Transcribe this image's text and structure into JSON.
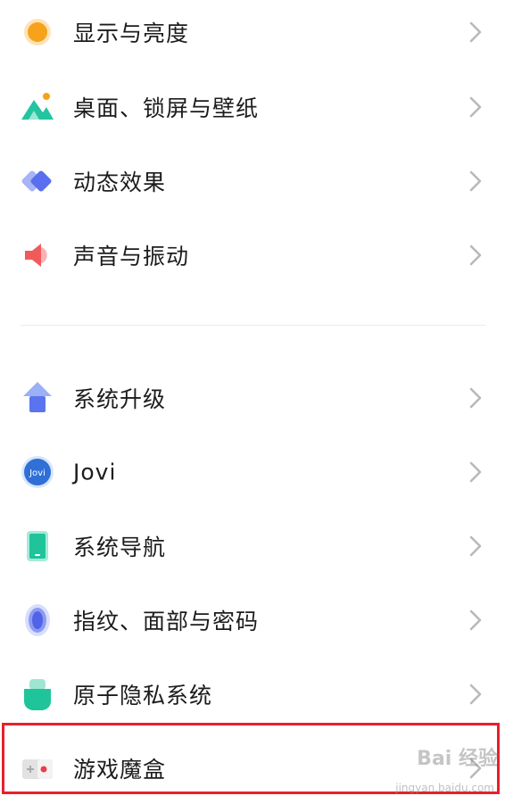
{
  "settings_list": {
    "group_1": [
      {
        "label": "显示与亮度",
        "icon": "display-brightness-icon"
      },
      {
        "label": "桌面、锁屏与壁纸",
        "icon": "wallpaper-icon"
      },
      {
        "label": "动态效果",
        "icon": "dynamic-effects-icon"
      },
      {
        "label": "声音与振动",
        "icon": "sound-vibration-icon"
      }
    ],
    "group_2": [
      {
        "label": "系统升级",
        "icon": "system-upgrade-icon"
      },
      {
        "label": "Jovi",
        "icon": "jovi-icon",
        "icon_text": "Jovi"
      },
      {
        "label": "系统导航",
        "icon": "system-navigation-icon"
      },
      {
        "label": "指纹、面部与密码",
        "icon": "fingerprint-icon"
      },
      {
        "label": "原子隐私系统",
        "icon": "atom-privacy-icon"
      },
      {
        "label": "游戏魔盒",
        "icon": "game-box-icon"
      }
    ]
  },
  "colors": {
    "highlight_border": "#e8202a",
    "chevron": "#b8b8b8",
    "divider": "#ececec"
  },
  "watermark": {
    "main": "Bai 经验",
    "sub": "jingyan.baidu.com"
  }
}
